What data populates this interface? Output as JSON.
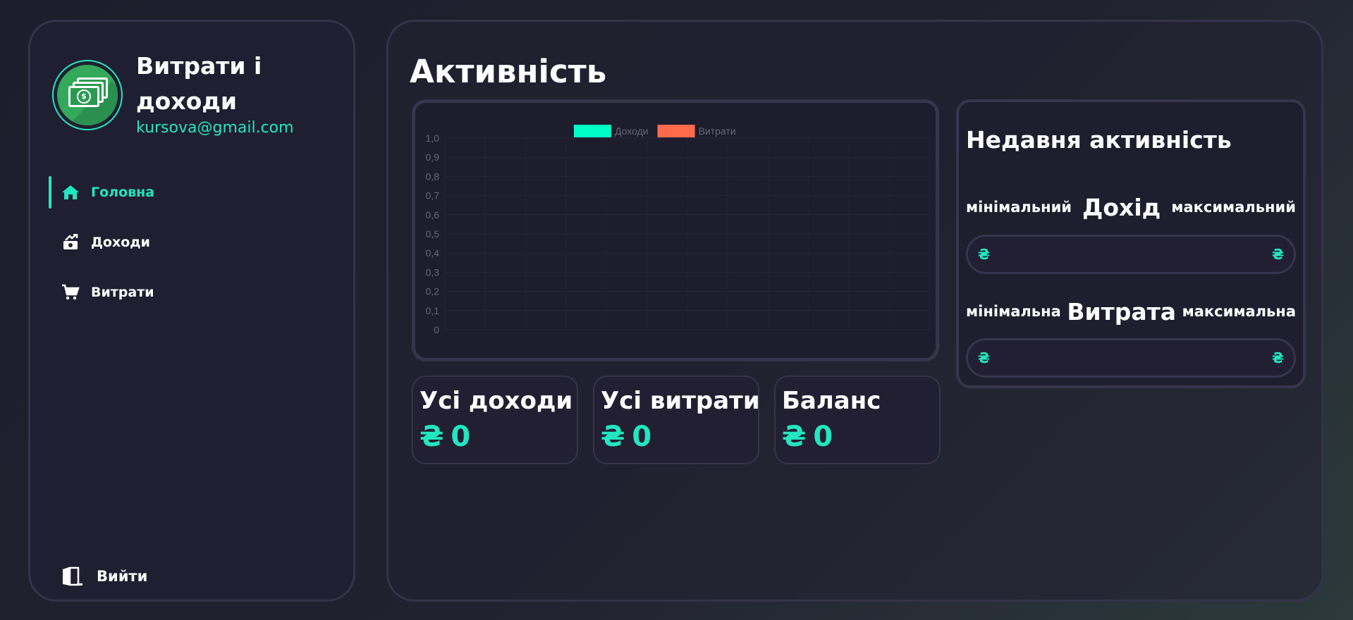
{
  "sidebar": {
    "app_title": "Витрати і доходи",
    "email": "kursova@gmail.com",
    "nav": [
      {
        "label": "Головна",
        "icon": "home-icon",
        "active": true
      },
      {
        "label": "Доходи",
        "icon": "money-hand-icon",
        "active": false
      },
      {
        "label": "Витрати",
        "icon": "cart-icon",
        "active": false
      }
    ],
    "logout_label": "Вийти"
  },
  "main": {
    "title": "Активність",
    "stats": [
      {
        "title": "Усі доходи",
        "currency": "₴",
        "value": "0"
      },
      {
        "title": "Усі витрати",
        "currency": "₴",
        "value": "0"
      },
      {
        "title": "Баланс",
        "currency": "₴",
        "value": "0"
      }
    ],
    "recent": {
      "title": "Недавня активність",
      "income": {
        "min_label": "мінімальний",
        "label": "Дохід",
        "max_label": "максимальний",
        "currency_left": "₴",
        "currency_right": "₴"
      },
      "expense": {
        "min_label": "мінімальна",
        "label": "Витрата",
        "max_label": "максимальна",
        "currency_left": "₴",
        "currency_right": "₴"
      }
    }
  },
  "colors": {
    "accent": "#22e6c0",
    "income_series": "#00ffc8",
    "expense_series": "#ff6a4d"
  },
  "chart_data": {
    "type": "bar",
    "categories": [],
    "series": [
      {
        "name": "Доходи",
        "color": "#00ffc8",
        "values": []
      },
      {
        "name": "Витрати",
        "color": "#ff6a4d",
        "values": []
      }
    ],
    "ylim": [
      0,
      1.0
    ],
    "yticks": [
      "0",
      "0,1",
      "0,2",
      "0,3",
      "0,4",
      "0,5",
      "0,6",
      "0,7",
      "0,8",
      "0,9",
      "1,0"
    ],
    "grid": true,
    "legend": "top-center"
  }
}
